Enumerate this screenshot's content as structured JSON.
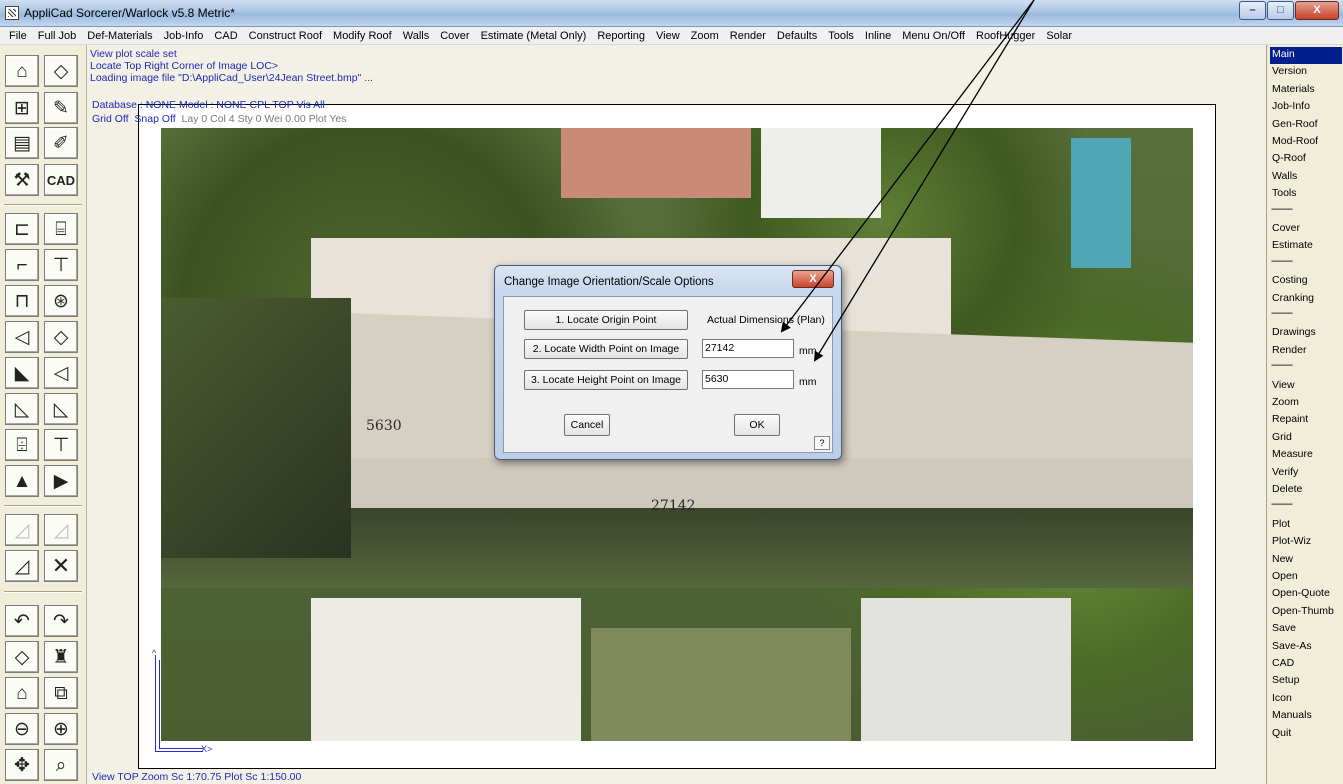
{
  "window": {
    "title": "AppliCad Sorcerer/Warlock v5.8 Metric*",
    "buttons": [
      "–",
      "□",
      "X"
    ]
  },
  "menu": [
    "File",
    "Full Job",
    "Def-Materials",
    "Job-Info",
    "CAD",
    "Construct Roof",
    "Modify Roof",
    "Walls",
    "Cover",
    "Estimate (Metal Only)",
    "Reporting",
    "View",
    "Zoom",
    "Render",
    "Defaults",
    "Tools",
    "Inline",
    "Menu On/Off",
    "RoofHugger",
    "Solar"
  ],
  "messages": [
    "View plot scale set",
    "Locate Top Right Corner of Image LOC>",
    "Loading image file \"D:\\AppliCad_User\\24Jean Street.bmp\" ..."
  ],
  "status": {
    "line1": "Database : NONE   Model : NONE  CPL TOP  Vis All",
    "grid": "Grid Off",
    "snap": "Snap Off",
    "layer_info": "Lay 0   Col 4   Sty 0   Wei 0.00   Plot Yes",
    "bottom": "View TOP  Zoom Sc 1:70.75  Plot Sc 1:150.00"
  },
  "canvas": {
    "axis_x_label": "X>",
    "axis_y_label": "^",
    "image_labels": {
      "height": "5630",
      "width": "27142"
    }
  },
  "toolbox": {
    "cad_label": "CAD",
    "delete_label": "✕"
  },
  "right_panel": {
    "items": [
      "Main",
      "Version",
      "Materials",
      "Job-Info",
      "Gen-Roof",
      "Mod-Roof",
      "Q-Roof",
      "Walls",
      "Tools",
      "---------",
      "Cover",
      "Estimate",
      "---------",
      "Costing",
      "Cranking",
      "---------",
      "Drawings",
      "Render",
      "---------",
      "View",
      "Zoom",
      "Repaint",
      "Grid",
      "Measure",
      "Verify",
      "Delete",
      "---------",
      "Plot",
      "Plot-Wiz",
      "New",
      "Open",
      "Open-Quote",
      "Open-Thumb",
      "Save",
      "Save-As",
      "CAD",
      "Setup",
      "Icon",
      "Manuals",
      "Quit"
    ],
    "selected": "Main"
  },
  "dialog": {
    "title": "Change Image Orientation/Scale Options",
    "close": "X",
    "btn_origin": "1. Locate Origin Point",
    "btn_width": "2. Locate Width Point on Image",
    "btn_height": "3. Locate Height Point on Image",
    "label_actual": "Actual Dimensions (Plan)",
    "width_value": "27142",
    "height_value": "5630",
    "unit_width": "mm",
    "unit_height": "mm",
    "cancel": "Cancel",
    "ok": "OK",
    "help": "?"
  },
  "colors": {
    "selection": "#001f8c",
    "message_text": "#1b2bb5",
    "panel_bg": "#f0edd9"
  }
}
